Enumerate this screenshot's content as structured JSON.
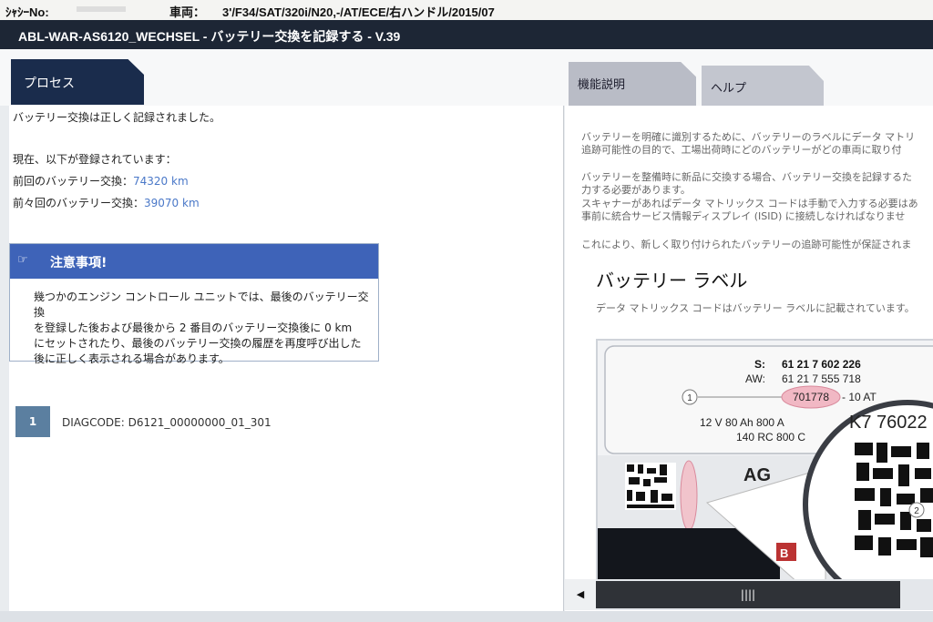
{
  "header": {
    "chassis_label": "ｼｬｼｰNo:",
    "vehicle_label": "車両：",
    "vehicle_value": "3'/F34/SAT/320i/N20,-/AT/ECE/右ハンドル/2015/07"
  },
  "window": {
    "title": "ABL-WAR-AS6120_WECHSEL - バッテリー交換を記録する - V.39"
  },
  "tabs": {
    "process": "プロセス",
    "function": "機能説明",
    "help": "ヘルプ"
  },
  "left": {
    "success_msg": "バッテリー交換は正しく記録されました。",
    "registered_intro": "現在、以下が登録されています：",
    "prev_label": "前回のバッテリー交換：",
    "prev_value": "74320 km",
    "prev2_label": "前々回のバッテリー交換：",
    "prev2_value": "39070 km",
    "notice": {
      "icon": "☞",
      "title": "注意事項!",
      "lines": [
        "幾つかのエンジン コントロール ユニットでは、最後のバッテリー交換",
        "を登録した後および最後から 2 番目のバッテリー交換後に 0 km",
        "にセットされたり、最後のバッテリー交換の履歴を再度呼び出した",
        "後に正しく表示される場合があります。"
      ]
    },
    "diag": {
      "number": "1",
      "code": "DIAGCODE: D6121_00000000_01_301"
    }
  },
  "right": {
    "para1": [
      "バッテリーを明確に識別するために、バッテリーのラベルにデータ マトリ",
      "追跡可能性の目的で、工場出荷時にどのバッテリーがどの車両に取り付"
    ],
    "para2": [
      "バッテリーを整備時に新品に交換する場合、バッテリー交換を記録するた",
      "力する必要があります。",
      "スキャナーがあればデータ マトリックス コードは手動で入力する必要はあ",
      "事前に統合サービス情報ディスプレイ (ISID) に接続しなければなりませ"
    ],
    "para3": "これにより、新しく取り付けられたバッテリーの追跡可能性が保証されま",
    "heading": "バッテリー ラベル",
    "caption": "データ マトリックス コードはバッテリー ラベルに記載されています。",
    "label": {
      "s_label": "S:",
      "s_value": "61 21 7 602 226",
      "aw_label": "AW:",
      "aw_value": "61 21 7 555 718",
      "highlight": "701778",
      "code_suffix": "- 10 AT",
      "spec1": "12 V  80 Ah   800 A",
      "spec2": "140 RC 800 C",
      "marker1": "1",
      "marker2": "2",
      "k7": "K7 76022",
      "agm": "AG",
      "b": "B"
    }
  },
  "scrollbar": {
    "left_arrow": "◀",
    "grip": "||||"
  }
}
